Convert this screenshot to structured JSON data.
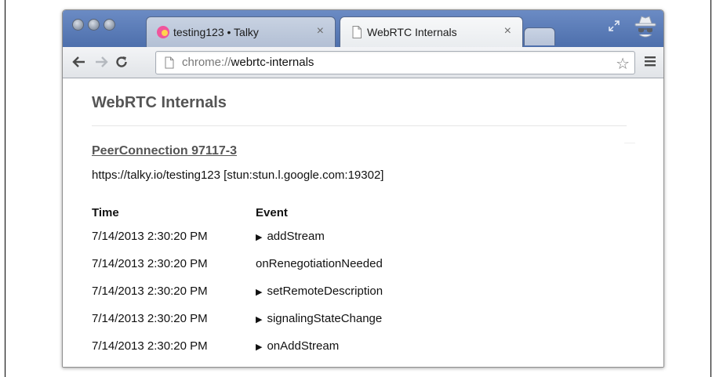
{
  "browser": {
    "tabs": [
      {
        "title": "testing123 • Talky",
        "close": "×",
        "active": false
      },
      {
        "title": "WebRTC Internals",
        "close": "×",
        "active": true
      }
    ],
    "address_scheme": "chrome://",
    "address_host": "webrtc-internals",
    "star": "☆"
  },
  "page": {
    "title": "WebRTC Internals",
    "peer_connection": "PeerConnection 97117-3",
    "connection_info": "https://talky.io/testing123 [stun:stun.l.google.com:19302]",
    "columns": {
      "time": "Time",
      "event": "Event"
    },
    "events": [
      {
        "time": "7/14/2013 2:30:20 PM",
        "event": "addStream",
        "expandable": true
      },
      {
        "time": "7/14/2013 2:30:20 PM",
        "event": "onRenegotiationNeeded",
        "expandable": false
      },
      {
        "time": "7/14/2013 2:30:20 PM",
        "event": "setRemoteDescription",
        "expandable": true
      },
      {
        "time": "7/14/2013 2:30:20 PM",
        "event": "signalingStateChange",
        "expandable": true
      },
      {
        "time": "7/14/2013 2:30:20 PM",
        "event": "onAddStream",
        "expandable": true
      }
    ],
    "expand_glyph": "▶"
  },
  "icons": {
    "window_controls": "traffic-light-icon",
    "talky_favicon": "talky-favicon-icon",
    "page": "page-icon",
    "back": "back-arrow-icon",
    "forward": "forward-arrow-icon",
    "reload": "reload-icon",
    "menu": "menu-icon",
    "incognito": "incognito-icon"
  }
}
